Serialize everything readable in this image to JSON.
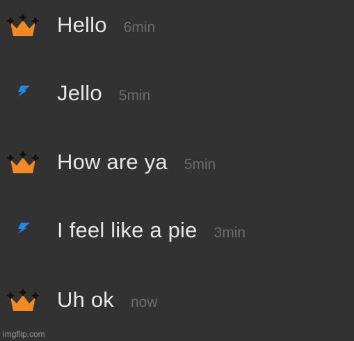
{
  "messages": [
    {
      "icon": "crown-icon",
      "text": "Hello",
      "time": "6min"
    },
    {
      "icon": "lightning-icon",
      "text": "Jello",
      "time": "5min"
    },
    {
      "icon": "crown-icon",
      "text": "How are ya",
      "time": "5min"
    },
    {
      "icon": "lightning-icon",
      "text": "I feel like a pie",
      "time": "3min"
    },
    {
      "icon": "crown-icon",
      "text": "Uh ok",
      "time": "now"
    }
  ],
  "watermark": "imgflip.com",
  "colors": {
    "background": "#323232",
    "message_text": "#e6e6e6",
    "timestamp": "#6c6c6c",
    "crown_orange": "#f08a24",
    "lightning_blue": "#1e88e5"
  }
}
